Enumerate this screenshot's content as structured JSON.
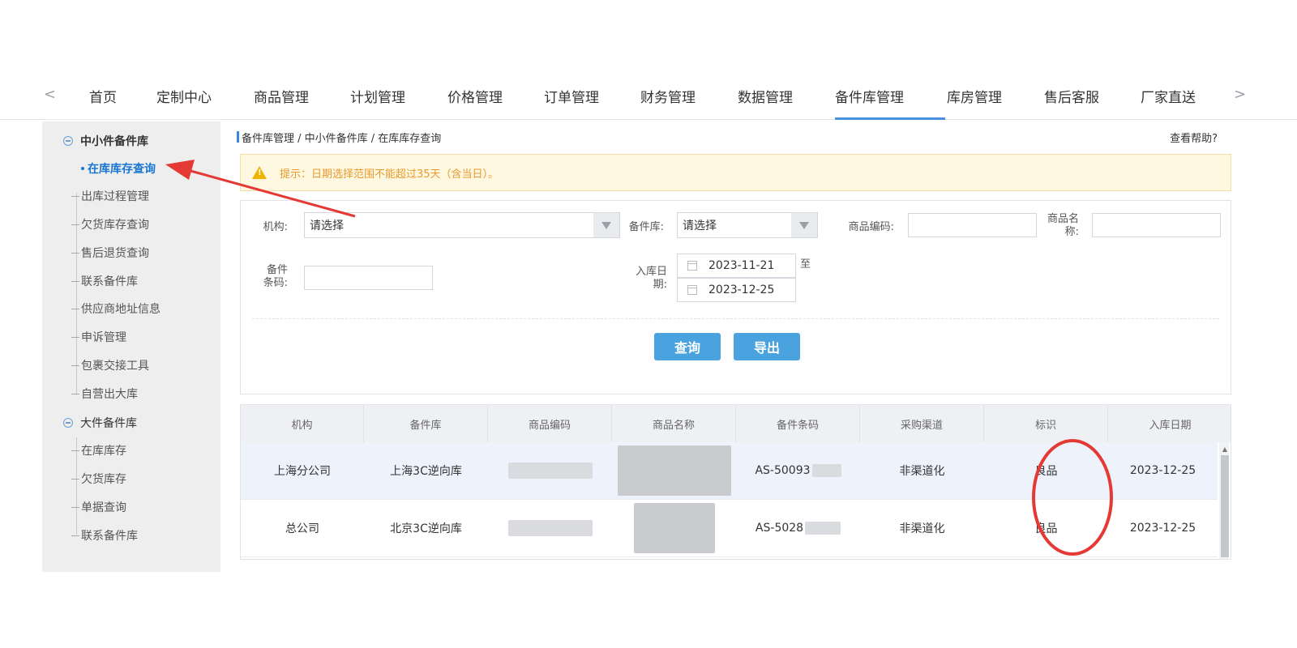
{
  "nav": {
    "prev_arrow": "<",
    "next_arrow": ">",
    "items": [
      "首页",
      "定制中心",
      "商品管理",
      "计划管理",
      "价格管理",
      "订单管理",
      "财务管理",
      "数据管理",
      "备件库管理",
      "库房管理",
      "售后客服",
      "厂家直送"
    ],
    "active": "备件库管理"
  },
  "sidebar": {
    "group1": {
      "title": "中小件备件库",
      "items": [
        "在库库存查询",
        "出库过程管理",
        "欠货库存查询",
        "售后退货查询",
        "联系备件库",
        "供应商地址信息",
        "申诉管理",
        "包裹交接工具",
        "自营出大库"
      ],
      "active": "在库库存查询"
    },
    "group2": {
      "title": "大件备件库",
      "items": [
        "在库库存",
        "欠货库存",
        "单据查询",
        "联系备件库"
      ]
    }
  },
  "breadcrumb": "备件库管理 / 中小件备件库 / 在库库存查询",
  "help_link": "查看帮助?",
  "notice": {
    "icon": "warning-icon",
    "text": "提示：日期选择范围不能超过35天（含当日）。"
  },
  "form": {
    "org_label": "机构:",
    "org_value": "请选择",
    "warehouse_label": "备件库:",
    "warehouse_value": "请选择",
    "product_code_label": "商品编码:",
    "product_name_label": "商品名称:",
    "barcode_label": "备件条码:",
    "date_label": "入库日期:",
    "date_from": "2023-11-21",
    "date_to_label": "至",
    "date_to": "2023-12-25",
    "query_button": "查询",
    "export_button": "导出"
  },
  "table": {
    "headers": [
      "机构",
      "备件库",
      "商品编码",
      "商品名称",
      "备件条码",
      "采购渠道",
      "标识",
      "入库日期"
    ],
    "rows": [
      {
        "org": "上海分公司",
        "warehouse": "上海3C逆向库",
        "barcode": "AS-50093",
        "channel": "非渠道化",
        "mark": "良品",
        "date": "2023-12-25"
      },
      {
        "org": "总公司",
        "warehouse": "北京3C逆向库",
        "barcode": "AS-5028",
        "channel": "非渠道化",
        "mark": "良品",
        "date": "2023-12-25"
      }
    ]
  },
  "colors": {
    "accent": "#4a90e2",
    "button": "#4aa3df",
    "annotation": "#e53935",
    "notice_text": "#e89a2e"
  }
}
